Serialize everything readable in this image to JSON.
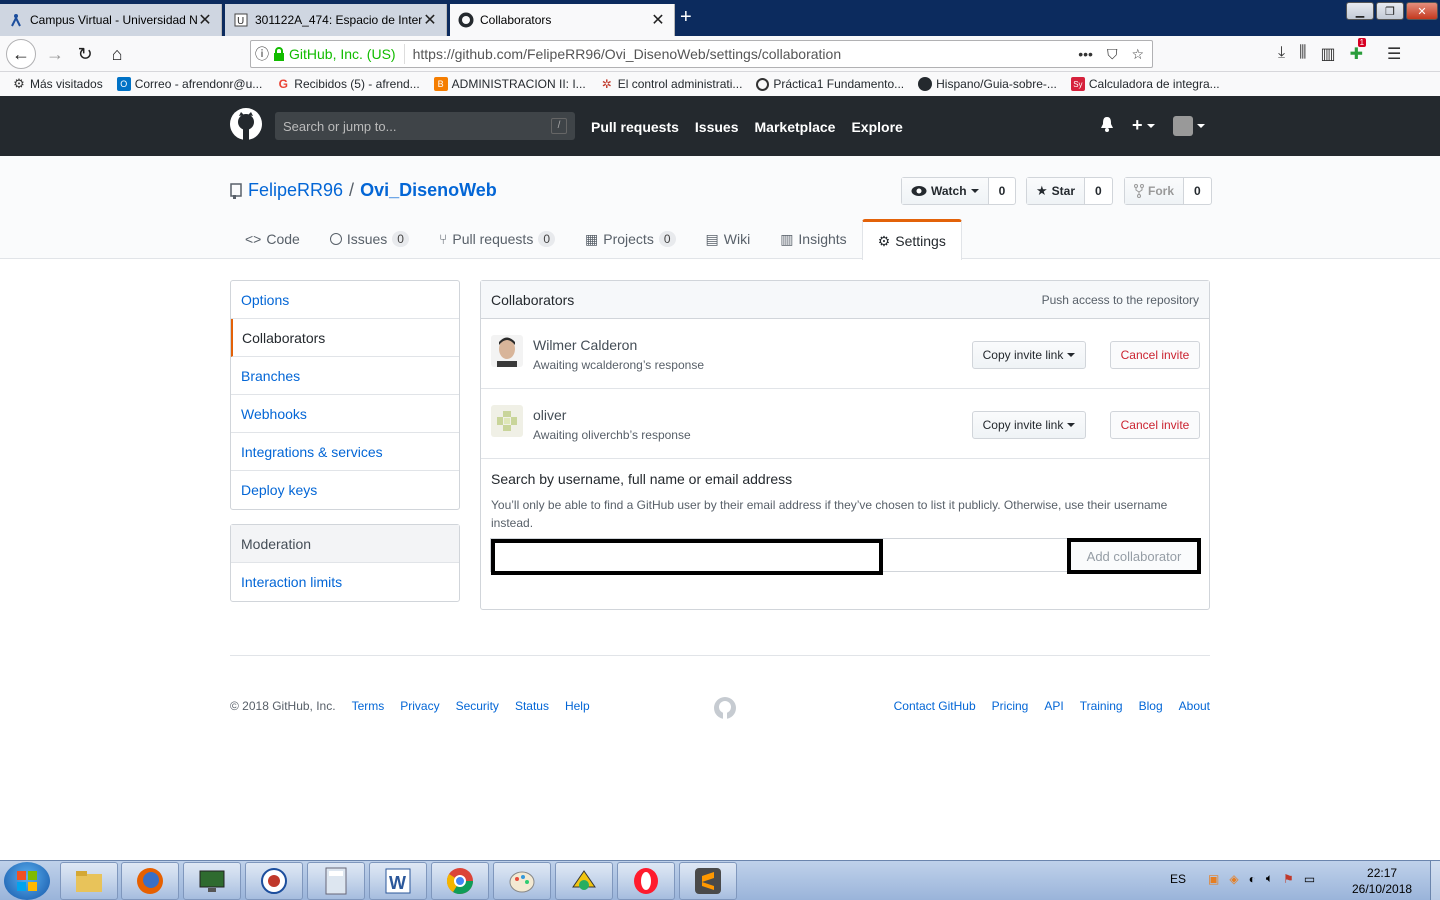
{
  "browser": {
    "tabs": [
      {
        "title": "Campus Virtual - Universidad N",
        "state": "inactive"
      },
      {
        "title": "301122A_474: Espacio de Intera",
        "state": "inactive"
      },
      {
        "title": "Collaborators",
        "state": "active"
      }
    ],
    "url": {
      "identity": "GitHub, Inc. (US)",
      "address": "https://github.com/FelipeRR96/Ovi_DisenoWeb/settings/collaboration"
    },
    "notification_badge": "1",
    "bookmarks": [
      {
        "label": "Más visitados",
        "icon": "gear-icon"
      },
      {
        "label": "Correo - afrendonr@u...",
        "icon": "outlook-icon",
        "color": "#0072c6"
      },
      {
        "label": "Recibidos (5) - afrend...",
        "icon": "google-icon",
        "color": "#ea4335"
      },
      {
        "label": "ADMINISTRACION II: I...",
        "icon": "blogger-icon",
        "color": "#f57d00"
      },
      {
        "label": "El control administrati...",
        "icon": "slideshare-icon",
        "color": "#c0392b"
      },
      {
        "label": "Práctica1 Fundamento...",
        "icon": "logo-icon",
        "color": "#333333"
      },
      {
        "label": "Hispano/Guia-sobre-...",
        "icon": "github-icon",
        "color": "#24292e"
      },
      {
        "label": "Calculadora de integra...",
        "icon": "symbolab-icon",
        "color": "#d6213c"
      }
    ]
  },
  "gh_header": {
    "search_placeholder": "Search or jump to...",
    "search_key": "/",
    "nav": [
      "Pull requests",
      "Issues",
      "Marketplace",
      "Explore"
    ]
  },
  "repo": {
    "owner": "FelipeRR96",
    "separator": "/",
    "name": "Ovi_DisenoWeb",
    "watch": {
      "label": "Watch",
      "count": "0"
    },
    "star": {
      "label": "Star",
      "count": "0"
    },
    "fork": {
      "label": "Fork",
      "count": "0"
    },
    "tabs": {
      "code": "Code",
      "issues": "Issues",
      "issues_count": "0",
      "pulls": "Pull requests",
      "pulls_count": "0",
      "projects": "Projects",
      "projects_count": "0",
      "wiki": "Wiki",
      "insights": "Insights",
      "settings": "Settings"
    }
  },
  "settings_menu": {
    "items": [
      "Options",
      "Collaborators",
      "Branches",
      "Webhooks",
      "Integrations & services",
      "Deploy keys"
    ],
    "moderation_heading": "Moderation",
    "moderation_items": [
      "Interaction limits"
    ]
  },
  "collaborators": {
    "title": "Collaborators",
    "note": "Push access to the repository",
    "entries": [
      {
        "name": "Wilmer Calderon",
        "status": "Awaiting wcalderong’s response",
        "copy_label": "Copy invite link",
        "cancel_label": "Cancel invite"
      },
      {
        "name": "oliver",
        "status": "Awaiting oliverchb’s response",
        "copy_label": "Copy invite link",
        "cancel_label": "Cancel invite"
      }
    ],
    "search_label": "Search by username, full name or email address",
    "search_help": "You’ll only be able to find a GitHub user by their email address if they’ve chosen to list it publicly. Otherwise, use their username instead.",
    "input_value": "",
    "add_button": "Add collaborator"
  },
  "footer": {
    "copyright": "© 2018 GitHub, Inc.",
    "left_links": [
      "Terms",
      "Privacy",
      "Security",
      "Status",
      "Help"
    ],
    "right_links": [
      "Contact GitHub",
      "Pricing",
      "API",
      "Training",
      "Blog",
      "About"
    ]
  },
  "taskbar": {
    "language": "ES",
    "time": "22:17",
    "date": "26/10/2018"
  }
}
